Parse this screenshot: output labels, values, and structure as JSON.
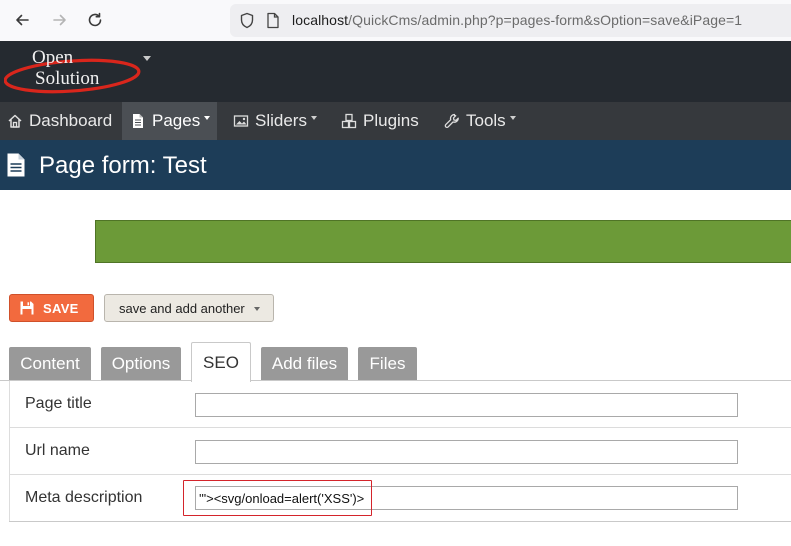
{
  "browser": {
    "url_host": "localhost",
    "url_path": "/QuickCms/admin.php?p=pages-form&sOption=save&iPage=1"
  },
  "logo": {
    "line1": "Open",
    "line2": "Solution"
  },
  "nav": {
    "items": [
      {
        "label": "Dashboard",
        "icon": "home-icon"
      },
      {
        "label": "Pages",
        "icon": "document-icon"
      },
      {
        "label": "Sliders",
        "icon": "image-icon"
      },
      {
        "label": "Plugins",
        "icon": "cubes-icon"
      },
      {
        "label": "Tools",
        "icon": "wrench-icon"
      }
    ]
  },
  "page": {
    "title": "Page form: Test"
  },
  "buttons": {
    "save_label": "SAVE",
    "save_add_label": "save and add another"
  },
  "tabs": [
    "Content",
    "Options",
    "SEO",
    "Add files",
    "Files"
  ],
  "active_tab": "SEO",
  "form": {
    "page_title_label": "Page title",
    "page_title_value": "",
    "url_name_label": "Url name",
    "url_name_value": "",
    "meta_description_label": "Meta description",
    "meta_description_value": "'\"><svg/onload=alert('XSS')>"
  },
  "colors": {
    "header_bg": "#252a30",
    "nav_bg": "#36393d",
    "titlebar_bg": "#1d3d58",
    "message_green": "#6c9a38",
    "save_orange": "#f26a3e",
    "highlight_red": "#d4242b"
  }
}
